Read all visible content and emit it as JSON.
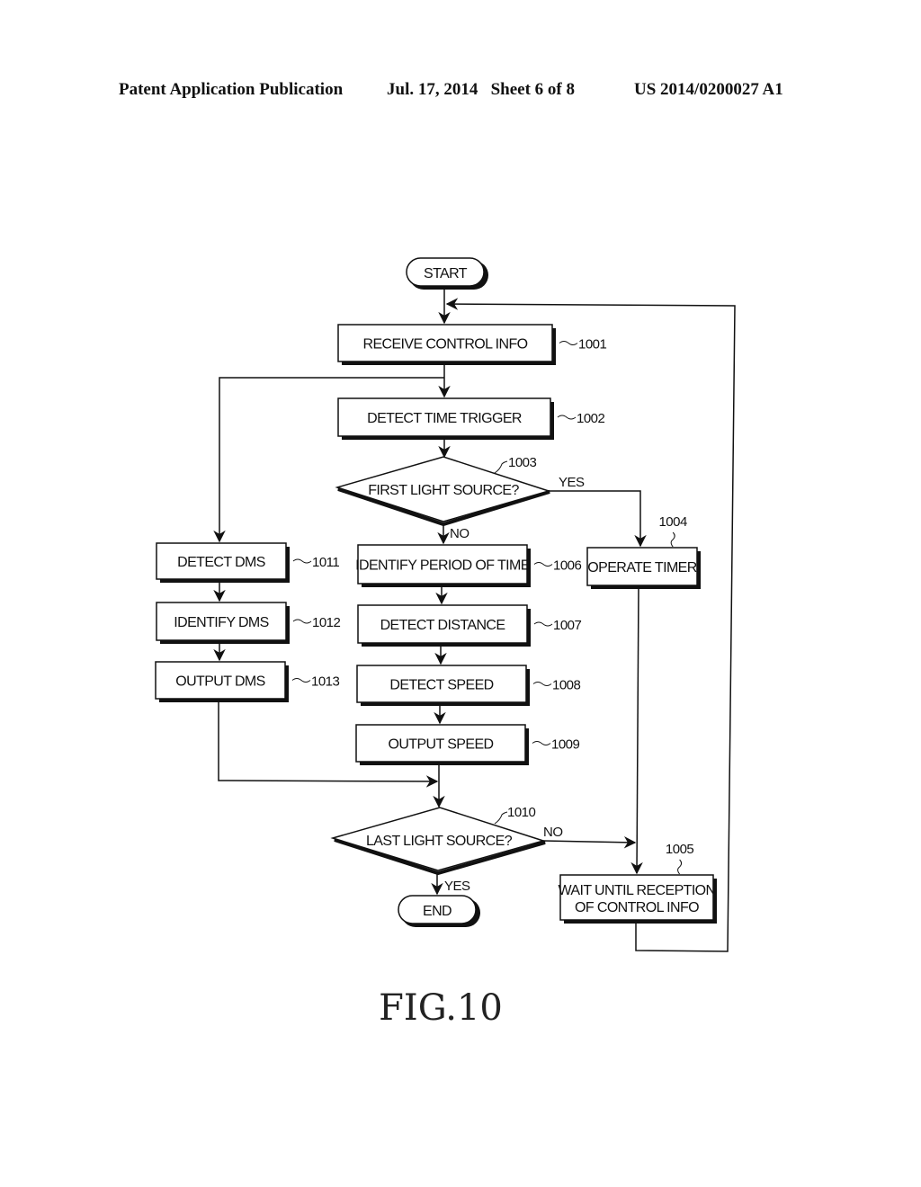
{
  "header": {
    "publication": "Patent Application Publication",
    "date_sheet": "Jul. 17, 2014   Sheet 6 of 8",
    "number": "US 2014/0200027 A1"
  },
  "figure_label": "FIG.10",
  "flowchart": {
    "start": "START",
    "end": "END",
    "steps": {
      "s1001": {
        "text": "RECEIVE CONTROL INFO",
        "ref": "1001"
      },
      "s1002": {
        "text": "DETECT TIME TRIGGER",
        "ref": "1002"
      },
      "s1003": {
        "text": "FIRST LIGHT SOURCE?",
        "ref": "1003",
        "yes": "YES",
        "no": "NO"
      },
      "s1004": {
        "text": "OPERATE TIMER",
        "ref": "1004"
      },
      "s1005": {
        "line1": "WAIT UNTIL RECEPTION",
        "line2": "OF CONTROL INFO",
        "ref": "1005"
      },
      "s1006": {
        "text": "IDENTIFY PERIOD OF TIME",
        "ref": "1006"
      },
      "s1007": {
        "text": "DETECT DISTANCE",
        "ref": "1007"
      },
      "s1008": {
        "text": "DETECT SPEED",
        "ref": "1008"
      },
      "s1009": {
        "text": "OUTPUT SPEED",
        "ref": "1009"
      },
      "s1010": {
        "text": "LAST LIGHT SOURCE?",
        "ref": "1010",
        "yes": "YES",
        "no": "NO"
      },
      "s1011": {
        "text": "DETECT DMS",
        "ref": "1011"
      },
      "s1012": {
        "text": "IDENTIFY DMS",
        "ref": "1012"
      },
      "s1013": {
        "text": "OUTPUT DMS",
        "ref": "1013"
      }
    }
  }
}
